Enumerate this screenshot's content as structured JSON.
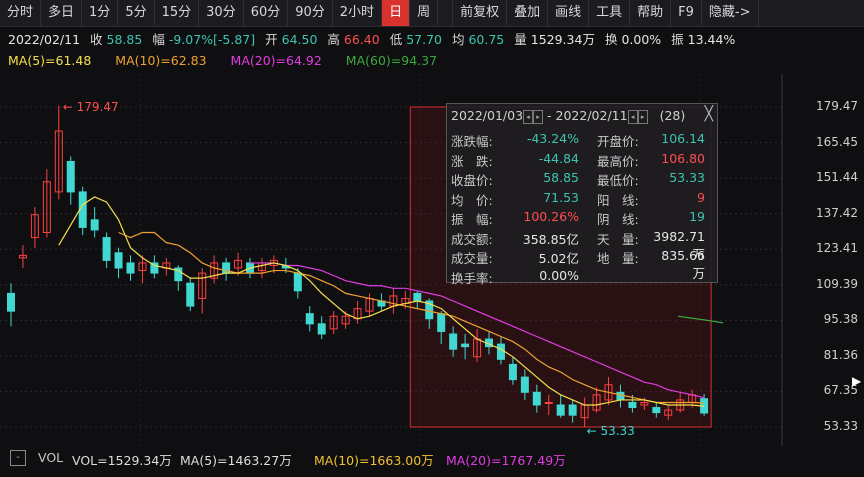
{
  "toolbar": {
    "items": [
      "分时",
      "多日",
      "1分",
      "5分",
      "15分",
      "30分",
      "60分",
      "90分",
      "2小时",
      "日",
      "周"
    ],
    "active": "日",
    "right_items": [
      "前复权",
      "叠加",
      "画线",
      "工具",
      "帮助",
      "F9",
      "隐藏->"
    ]
  },
  "info": {
    "date": "2022/02/11",
    "close_label": "收",
    "close": "58.85",
    "change_label": "幅",
    "change": "-9.07%[-5.87]",
    "open_label": "开",
    "open": "64.50",
    "high_label": "高",
    "high": "66.40",
    "low_label": "低",
    "low": "57.70",
    "avg_label": "均",
    "avg": "60.75",
    "vol_label": "量",
    "vol": "1529.34万",
    "turnover_label": "换",
    "turnover": "0.00%",
    "amp_label": "振",
    "amp": "13.44%"
  },
  "ma": {
    "ma5": "MA(5)=61.48",
    "ma10": "MA(10)=62.83",
    "ma20": "MA(20)=64.92",
    "ma60": "MA(60)=94.37",
    "colors": {
      "ma5": "#f5e04a",
      "ma10": "#f0a030",
      "ma20": "#e03ce0",
      "ma60": "#3ca83c"
    }
  },
  "colors": {
    "up": "#ff4040",
    "down": "#40d8d0",
    "box": "#d83030"
  },
  "chart_data": {
    "type": "candlestick",
    "yticks": [
      "179.47",
      "165.45",
      "151.44",
      "137.42",
      "123.41",
      "109.39",
      "95.38",
      "81.36",
      "67.35",
      "53.33"
    ],
    "ylim": [
      53.33,
      179.47
    ],
    "annotations": [
      {
        "label": "179.47",
        "type": "max"
      },
      {
        "label": "53.33",
        "type": "min"
      }
    ],
    "candles": [
      [
        106,
        99,
        110,
        93
      ],
      [
        120,
        121,
        125,
        116
      ],
      [
        128,
        137,
        140,
        124
      ],
      [
        130,
        150,
        155,
        128
      ],
      [
        146,
        170,
        180,
        143
      ],
      [
        158,
        146,
        160,
        141
      ],
      [
        146,
        132,
        148,
        129
      ],
      [
        135,
        131,
        140,
        128
      ],
      [
        128,
        119,
        130,
        116
      ],
      [
        122,
        116,
        124,
        112
      ],
      [
        118,
        114,
        121,
        111
      ],
      [
        115,
        118,
        121,
        110
      ],
      [
        118,
        114,
        121,
        112
      ],
      [
        116,
        118,
        120,
        113
      ],
      [
        116,
        111,
        117,
        107
      ],
      [
        110,
        101,
        112,
        99
      ],
      [
        104,
        114,
        116,
        98
      ],
      [
        112,
        118,
        121,
        110
      ],
      [
        118,
        114,
        120,
        111
      ],
      [
        116,
        119,
        122,
        113
      ],
      [
        118,
        114,
        120,
        112
      ],
      [
        115,
        118,
        120,
        112
      ],
      [
        117,
        119,
        121,
        114
      ],
      [
        117,
        116,
        120,
        114
      ],
      [
        114,
        107,
        116,
        104
      ],
      [
        98,
        94,
        101,
        91
      ],
      [
        94,
        90,
        97,
        88
      ],
      [
        92,
        97,
        99,
        90
      ],
      [
        94,
        97,
        99,
        92
      ],
      [
        96,
        100,
        103,
        94
      ],
      [
        99,
        104,
        106,
        97
      ],
      [
        103,
        101,
        106,
        99
      ],
      [
        101,
        105,
        108,
        98
      ],
      [
        102,
        104,
        107,
        100
      ],
      [
        106,
        103,
        106.8,
        100
      ],
      [
        103,
        96,
        104,
        92
      ],
      [
        98,
        91,
        99,
        86
      ],
      [
        90,
        84,
        93,
        81
      ],
      [
        86,
        85,
        90,
        80
      ],
      [
        81,
        88,
        92,
        79
      ],
      [
        88,
        85,
        91,
        82
      ],
      [
        86,
        80,
        89,
        78
      ],
      [
        78,
        72,
        81,
        70
      ],
      [
        73,
        67,
        76,
        64
      ],
      [
        67,
        62,
        70,
        59
      ],
      [
        63,
        63,
        66,
        58
      ],
      [
        62,
        58,
        66,
        57
      ],
      [
        62,
        58,
        64,
        55
      ],
      [
        57,
        62,
        65,
        53.33
      ],
      [
        60,
        66,
        69,
        59
      ],
      [
        64,
        70,
        73,
        62
      ],
      [
        67,
        64,
        70,
        61
      ],
      [
        63,
        61,
        66,
        59
      ],
      [
        62,
        63,
        65,
        60
      ],
      [
        61,
        59,
        63,
        57
      ],
      [
        58,
        60,
        62,
        56
      ],
      [
        60,
        64,
        67,
        59
      ],
      [
        63,
        66,
        68,
        61
      ],
      [
        64.5,
        58.85,
        66.4,
        57.7
      ]
    ],
    "ma5": [
      null,
      null,
      null,
      null,
      125,
      133,
      141,
      144,
      142,
      135,
      124,
      120,
      117,
      116,
      115,
      112,
      112,
      113,
      114,
      114,
      116,
      117,
      118,
      117,
      115,
      111,
      106,
      102,
      98,
      96,
      97,
      99,
      101,
      102,
      103,
      102,
      100,
      96,
      92,
      88,
      86,
      84,
      81,
      77,
      73,
      69,
      66,
      64,
      62,
      62,
      63,
      64,
      64,
      64,
      63,
      62,
      62,
      62,
      61.5
    ],
    "ma10": [
      null,
      null,
      null,
      null,
      null,
      null,
      null,
      null,
      null,
      130,
      128,
      130,
      130,
      126,
      125,
      122,
      118,
      116,
      115,
      114,
      114,
      114,
      115,
      115,
      114,
      113,
      111,
      109,
      106,
      105,
      104,
      103,
      102,
      101,
      100,
      99,
      98,
      97,
      95,
      93,
      91,
      89,
      87,
      84,
      80,
      77,
      75,
      72,
      70,
      68,
      67,
      66,
      65,
      64,
      63,
      63,
      63,
      63,
      62.8
    ],
    "ma20": [
      null,
      null,
      null,
      null,
      null,
      null,
      null,
      null,
      null,
      null,
      null,
      null,
      null,
      null,
      null,
      null,
      null,
      null,
      null,
      null,
      118,
      118,
      118,
      117,
      117,
      116,
      115,
      113,
      111,
      110,
      109,
      109,
      108,
      108,
      107,
      106,
      105,
      103,
      101,
      99,
      97,
      95,
      93,
      91,
      89,
      87,
      85,
      83,
      81,
      79,
      77,
      75,
      73,
      71,
      70,
      68,
      67,
      66,
      64.9
    ],
    "ma60_segment": [
      97,
      96.5,
      96,
      95.5,
      95,
      94.37
    ],
    "box_range_from": 34,
    "box_range_to": 58
  },
  "popup": {
    "start_date": "2022/01/03",
    "end_date": "2022/02/11",
    "sep": "-",
    "count": "(28)",
    "close_x": "╳",
    "rows": [
      [
        "涨跌幅:",
        "-43.24%",
        "开盘价:",
        "106.14"
      ],
      [
        "涨　跌:",
        "-44.84",
        "最高价:",
        "106.80"
      ],
      [
        "收盘价:",
        "58.85",
        "最低价:",
        "53.33"
      ],
      [
        "均　价:",
        "71.53",
        "阳　线:",
        "9"
      ],
      [
        "振　幅:",
        "100.26%",
        "阴　线:",
        "19"
      ],
      [
        "成交额:",
        "358.85亿",
        "天　量:",
        "3982.71万"
      ],
      [
        "成交量:",
        "5.02亿",
        "地　量:",
        "835.66万"
      ],
      [
        "换手率:",
        "0.00%",
        "",
        ""
      ]
    ]
  },
  "vol": {
    "box": "-",
    "label": "VOL",
    "vol": "VOL=1529.34万",
    "ma5": "MA(5)=1463.27万",
    "ma10": "MA(10)=1663.00万",
    "ma20": "MA(20)=1767.49万"
  }
}
